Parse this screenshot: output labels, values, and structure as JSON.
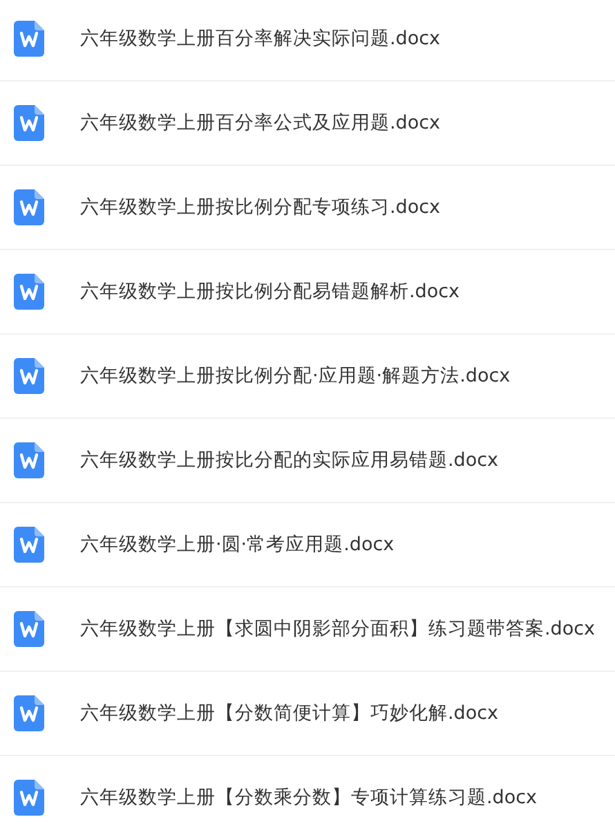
{
  "files": [
    {
      "name": "六年级数学上册百分率解决实际问题.docx",
      "kind": "word"
    },
    {
      "name": "六年级数学上册百分率公式及应用题.docx",
      "kind": "word"
    },
    {
      "name": "六年级数学上册按比例分配专项练习.docx",
      "kind": "word"
    },
    {
      "name": "六年级数学上册按比例分配易错题解析.docx",
      "kind": "word"
    },
    {
      "name": "六年级数学上册按比例分配·应用题·解题方法.docx",
      "kind": "word"
    },
    {
      "name": "六年级数学上册按比分配的实际应用易错题.docx",
      "kind": "word"
    },
    {
      "name": "六年级数学上册·圆·常考应用题.docx",
      "kind": "word"
    },
    {
      "name": "六年级数学上册【求圆中阴影部分面积】练习题带答案.docx",
      "kind": "word"
    },
    {
      "name": "六年级数学上册【分数简便计算】巧妙化解.docx",
      "kind": "word"
    },
    {
      "name": "六年级数学上册【分数乘分数】专项计算练习题.docx",
      "kind": "word"
    }
  ]
}
